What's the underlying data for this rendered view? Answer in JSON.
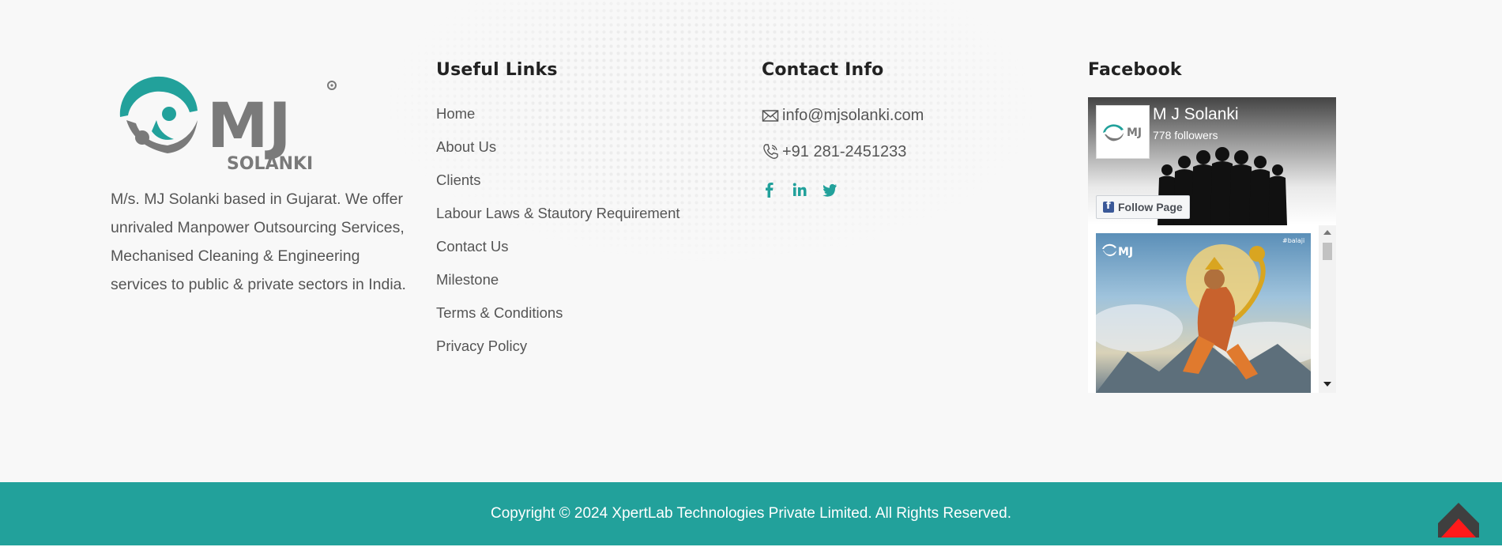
{
  "about": {
    "logo_name": "mj-solanki-logo",
    "logo_letters": "MJ",
    "logo_subtitle": "SOLANKI",
    "description": "M/s. MJ Solanki based in Gujarat. We offer unrivaled Manpower Outsourcing Services, Mechanised Cleaning & Engineering services to public & private sectors in India."
  },
  "links": {
    "title": "Useful Links",
    "items": [
      {
        "label": "Home"
      },
      {
        "label": "About Us"
      },
      {
        "label": "Clients"
      },
      {
        "label": "Labour Laws & Stautory Requirement"
      },
      {
        "label": "Contact Us"
      },
      {
        "label": "Milestone"
      },
      {
        "label": "Terms & Conditions"
      },
      {
        "label": "Privacy Policy"
      }
    ]
  },
  "contact": {
    "title": "Contact Info",
    "email": "info@mjsolanki.com",
    "phone": "+91 281-2451233",
    "social_icons": [
      "facebook-icon",
      "linkedin-icon",
      "twitter-icon"
    ]
  },
  "facebook": {
    "title": "Facebook",
    "page_name": "M J Solanki",
    "followers": "778 followers",
    "follow_label": "Follow Page",
    "post_tag": "#balaji"
  },
  "copyright": "Copyright © 2024 XpertLab Technologies Private Limited. All Rights Reserved.",
  "colors": {
    "accent": "#22a19b",
    "text": "#555555",
    "heading": "#222222",
    "scroll_top_arrow": "#ff1a1a"
  }
}
